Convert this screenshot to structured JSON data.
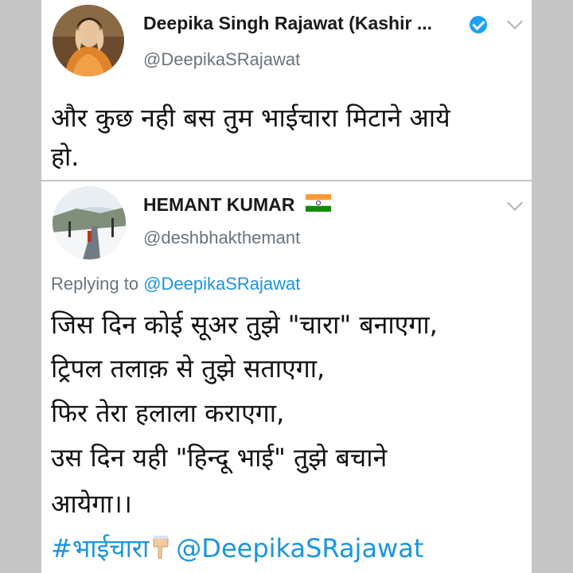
{
  "tweet1": {
    "name": "Deepika Singh Rajawat (Kashir ...",
    "handle": "@DeepikaSRajawat",
    "verified_icon": "verified-badge-icon",
    "menu_icon": "chevron-down-icon",
    "text_lines": [
      "और कुछ नही बस तुम भाईचारा मिटाने आये",
      "हो."
    ]
  },
  "tweet2": {
    "name": "HEMANT KUMAR",
    "flag_icon": "india-flag-icon",
    "handle": "@deshbhakthemant",
    "menu_icon": "chevron-down-icon",
    "reply_prefix": "Replying to ",
    "reply_mention": "@DeepikaSRajawat",
    "text_lines": [
      "जिस दिन कोई सूअर तुझे \"चारा\" बनाएगा,",
      "ट्रिपल तलाक़ से तुझे सताएगा,",
      "फिर तेरा हलाला कराएगा,",
      "उस दिन यही \"हिन्दू भाई\" तुझे बचाने",
      "आयेगा।।"
    ],
    "hashtag": "#भाईचारा",
    "hand_icon": "pointing-down-hand-icon",
    "mention": "@DeepikaSRajawat"
  },
  "colors": {
    "background": "#c6c6c6",
    "card": "#ffffff",
    "link": "#1b95e0",
    "secondary_text": "#68747f",
    "verified": "#1da1f2"
  }
}
